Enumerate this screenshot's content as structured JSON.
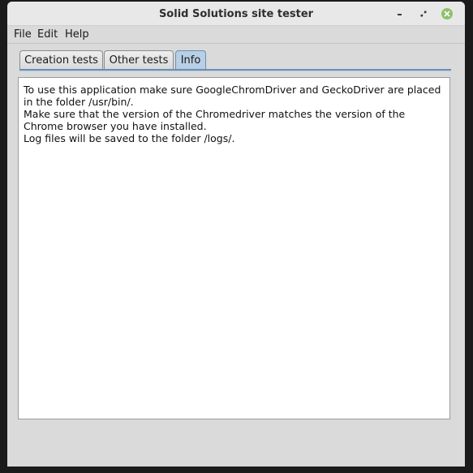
{
  "window": {
    "title": "Solid Solutions site tester"
  },
  "menubar": {
    "items": [
      {
        "label": "File"
      },
      {
        "label": "Edit"
      },
      {
        "label": "Help"
      }
    ]
  },
  "tabs": [
    {
      "label": "Creation tests",
      "active": false
    },
    {
      "label": "Other tests",
      "active": false
    },
    {
      "label": "Info",
      "active": true
    }
  ],
  "info": {
    "lines": [
      "To use this application make sure GoogleChromDriver and GeckoDriver are placed",
      "in the folder /usr/bin/.",
      "Make sure that the version of the Chromedriver matches the version of the",
      "Chrome browser you have installed.",
      "Log files will be saved to the folder /logs/."
    ]
  },
  "colors": {
    "close_button": "#8fc16a",
    "active_tab": "#b8cfe5",
    "tab_border_active": "#6b8fb3"
  },
  "icons": [
    "minimize-icon",
    "maximize-icon",
    "close-icon"
  ]
}
